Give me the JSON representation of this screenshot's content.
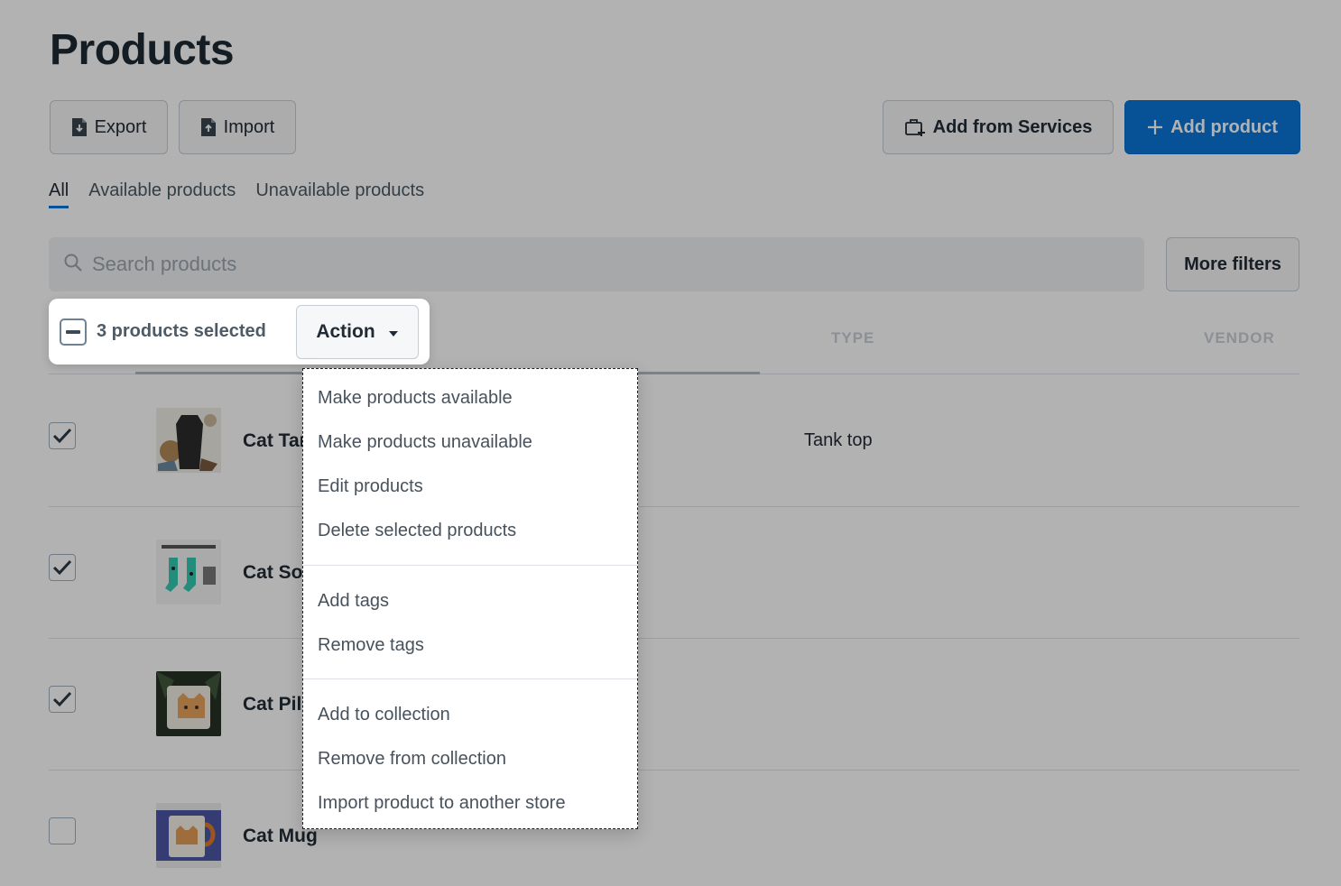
{
  "page": {
    "title": "Products"
  },
  "toolbar": {
    "export_label": "Export",
    "import_label": "Import",
    "services_label": "Add from Services",
    "add_label": "Add product"
  },
  "tabs": [
    {
      "label": "All",
      "active": true
    },
    {
      "label": "Available products",
      "active": false
    },
    {
      "label": "Unavailable products",
      "active": false
    }
  ],
  "search": {
    "placeholder": "Search products",
    "value": ""
  },
  "filters": {
    "more_label": "More filters"
  },
  "table": {
    "columns": {
      "type": "TYPE",
      "vendor": "VENDOR"
    },
    "rows": [
      {
        "name": "Cat Tank Top",
        "type": "Tank top",
        "checked": true
      },
      {
        "name": "Cat Socks",
        "type": "",
        "checked": true
      },
      {
        "name": "Cat Pillow",
        "type": "",
        "checked": true
      },
      {
        "name": "Cat Mug",
        "type": "",
        "checked": false
      }
    ]
  },
  "bulk": {
    "selected_label": "3 products selected",
    "action_label": "Action"
  },
  "action_menu": {
    "groups": [
      [
        "Make products available",
        "Make products unavailable",
        "Edit products",
        "Delete selected products"
      ],
      [
        "Add tags",
        "Remove tags"
      ],
      [
        "Add to collection",
        "Remove from collection",
        "Import product to another store"
      ]
    ]
  },
  "colors": {
    "primary": "#0b76d8",
    "overlay": "rgba(0,0,0,0.30)"
  }
}
